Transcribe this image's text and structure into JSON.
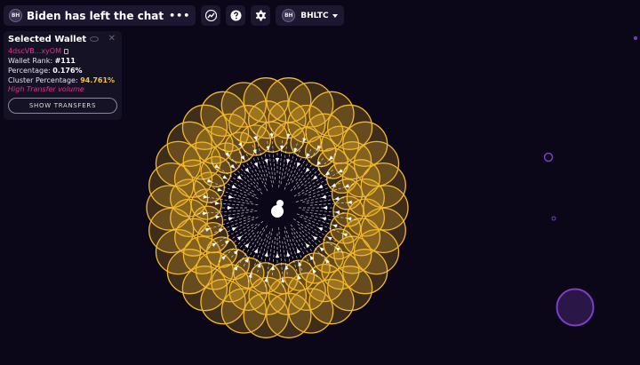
{
  "header": {
    "avatar_initials": "BH",
    "title": "Biden has left the chat",
    "more_label": "•••",
    "token_avatar_initials": "BH",
    "token_symbol": "BHLTC"
  },
  "wallet_panel": {
    "title": "Selected Wallet",
    "address": "4dscVB...xyOM",
    "rank_label": "Wallet Rank:",
    "rank_value": "#111",
    "percentage_label": "Percentage:",
    "percentage_value": "0.176%",
    "cluster_label": "Cluster Percentage:",
    "cluster_value": "94.761%",
    "warning": "High Transfer volume",
    "button_label": "SHOW TRANSFERS"
  },
  "icons": [
    "more-icon",
    "chart-icon",
    "help-icon",
    "gear-icon",
    "caret-down-icon",
    "eye-off-icon",
    "close-icon",
    "copy-icon"
  ],
  "colors": {
    "background": "#0c0718",
    "panel": "#151225",
    "accent_pink": "#e0338e",
    "accent_yellow": "#f6c23c",
    "bubble_gold": "#f2b82a",
    "bubble_purple": "#7a3fc4"
  }
}
